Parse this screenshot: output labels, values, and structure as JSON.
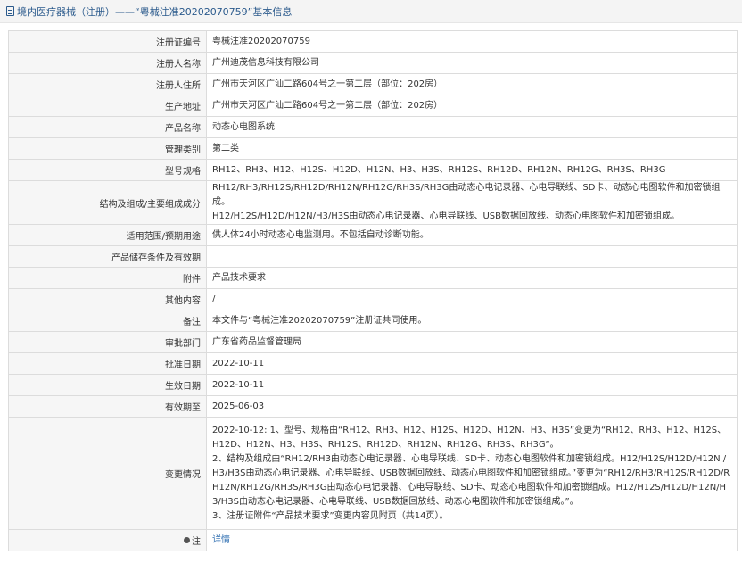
{
  "header": {
    "icon": "document-icon",
    "title": "境内医疗器械（注册）——“粤械注准20202070759”基本信息"
  },
  "rows": {
    "reg_no": {
      "label": "注册证编号",
      "value": "粤械注准20202070759"
    },
    "registrant": {
      "label": "注册人名称",
      "value": "广州迪茂信息科技有限公司"
    },
    "address": {
      "label": "注册人住所",
      "value": "广州市天河区广汕二路604号之一第二层（部位：202房）"
    },
    "production": {
      "label": "生产地址",
      "value": "广州市天河区广汕二路604号之一第二层（部位：202房）"
    },
    "product": {
      "label": "产品名称",
      "value": "动态心电图系统"
    },
    "category": {
      "label": "管理类别",
      "value": "第二类"
    },
    "models": {
      "label": "型号规格",
      "value": "RH12、RH3、H12、H12S、H12D、H12N、H3、H3S、RH12S、RH12D、RH12N、RH12G、RH3S、RH3G"
    },
    "composition": {
      "label": "结构及组成/主要组成成分",
      "lines": [
        "RH12/RH3/RH12S/RH12D/RH12N/RH12G/RH3S/RH3G由动态心电记录器、心电导联线、SD卡、动态心电图软件和加密锁组成。",
        "H12/H12S/H12D/H12N/H3/H3S由动态心电记录器、心电导联线、USB数据回放线、动态心电图软件和加密锁组成。"
      ]
    },
    "scope": {
      "label": "适用范围/预期用途",
      "value": "供人体24小时动态心电监测用。不包括自动诊断功能。"
    },
    "storage": {
      "label": "产品储存条件及有效期",
      "value": ""
    },
    "attachment": {
      "label": "附件",
      "value": "产品技术要求"
    },
    "other": {
      "label": "其他内容",
      "value": "/"
    },
    "remark": {
      "label": "备注",
      "value": "本文件与“粤械注准20202070759”注册证共同使用。"
    },
    "authority": {
      "label": "审批部门",
      "value": "广东省药品监督管理局"
    },
    "approve_date": {
      "label": "批准日期",
      "value": "2022-10-11"
    },
    "effective_date": {
      "label": "生效日期",
      "value": "2022-10-11"
    },
    "expire_date": {
      "label": "有效期至",
      "value": "2025-06-03"
    },
    "changes": {
      "label": "变更情况",
      "lines": [
        "2022-10-12: 1、型号、规格由“RH12、RH3、H12、H12S、H12D、H12N、H3、H3S”变更为“RH12、RH3、H12、H12S、H12D、H12N、H3、H3S、RH12S、RH12D、RH12N、RH12G、RH3S、RH3G”。",
        "2、结构及组成由“RH12/RH3由动态心电记录器、心电导联线、SD卡、动态心电图软件和加密锁组成。H12/H12S/H12D/H12N /H3/H3S由动态心电记录器、心电导联线、USB数据回放线、动态心电图软件和加密锁组成。”变更为“RH12/RH3/RH12S/RH12D/RH12N/RH12G/RH3S/RH3G由动态心电记录器、心电导联线、SD卡、动态心电图软件和加密锁组成。H12/H12S/H12D/H12N/H3/H3S由动态心电记录器、心电导联线、USB数据回放线、动态心电图软件和加密锁组成。”。",
        "3、注册证附件“产品技术要求”变更内容见附页（共14页）。"
      ]
    },
    "note": {
      "label": "注",
      "icon": "info-icon",
      "link": "详情"
    }
  }
}
